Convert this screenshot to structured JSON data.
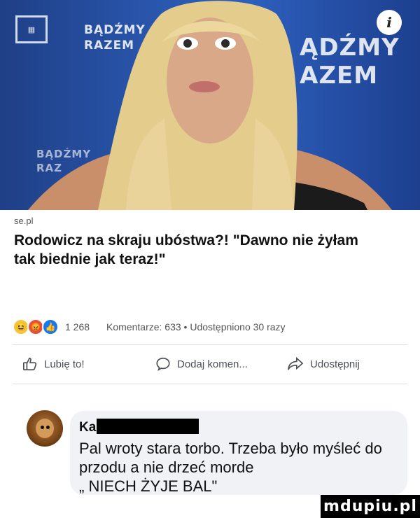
{
  "post": {
    "banner_texts": [
      "BĄDŹMY\nRAZEM",
      "ĄDŹMY\nAZEM",
      "BĄDŹMY\nRAZ"
    ],
    "info_label": "i",
    "source": "se.pl",
    "headline": "Rodowicz na skraju ubóstwa?! \"Dawno nie żyłam tak biednie jak teraz!\""
  },
  "stats": {
    "reactions": [
      "haha",
      "angry",
      "like"
    ],
    "reaction_count": "1 268",
    "comments_shares": "Komentarze: 633 • Udostępniono 30 razy"
  },
  "actions": {
    "like": "Lubię to!",
    "comment": "Dodaj komen...",
    "share": "Udostępnij"
  },
  "comment": {
    "author": "Ka",
    "text": "Pal wroty stara torbo. Trzeba było myśleć do przodu a nie drzeć morde\n„ NIECH ŻYJE BAL\""
  },
  "watermark": "mdupiu.pl",
  "colors": {
    "banner": "#2a58b0",
    "like": "#1877f2",
    "bubble": "#f0f2f5"
  }
}
